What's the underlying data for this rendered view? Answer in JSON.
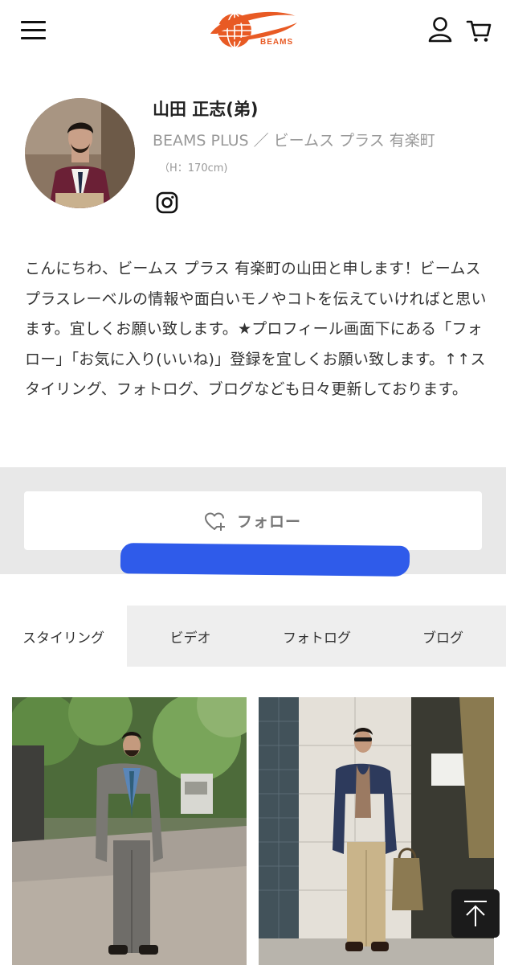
{
  "header": {
    "logo_text": "BEAMS",
    "menu_icon": "hamburger-menu-icon",
    "user_icon": "user-icon",
    "cart_icon": "cart-icon",
    "brand_color": "#e85a24"
  },
  "profile": {
    "name": "山田 正志(弟)",
    "shop": "BEAMS PLUS ／ ビームス プラス 有楽町",
    "height": "（H：170cm)",
    "social_icon": "instagram-icon",
    "bio": "こんにちわ、ビームス プラス 有楽町の山田と申します！ビームス プラスレーベルの情報や面白いモノやコトを伝えていければと思います。宜しくお願い致します。★プロフィール画面下にある「フォロー」「お気に入り(いいね)」登録を宜しくお願い致します。↑↑スタイリング、フォトログ、ブログなども日々更新しております。"
  },
  "follow": {
    "label": "フォロー",
    "icon": "heart-plus-icon"
  },
  "tabs": [
    {
      "label": "スタイリング",
      "active": true
    },
    {
      "label": "ビデオ",
      "active": false
    },
    {
      "label": "フォトログ",
      "active": false
    },
    {
      "label": "ブログ",
      "active": false
    }
  ],
  "scroll_top_icon": "arrow-up-icon"
}
